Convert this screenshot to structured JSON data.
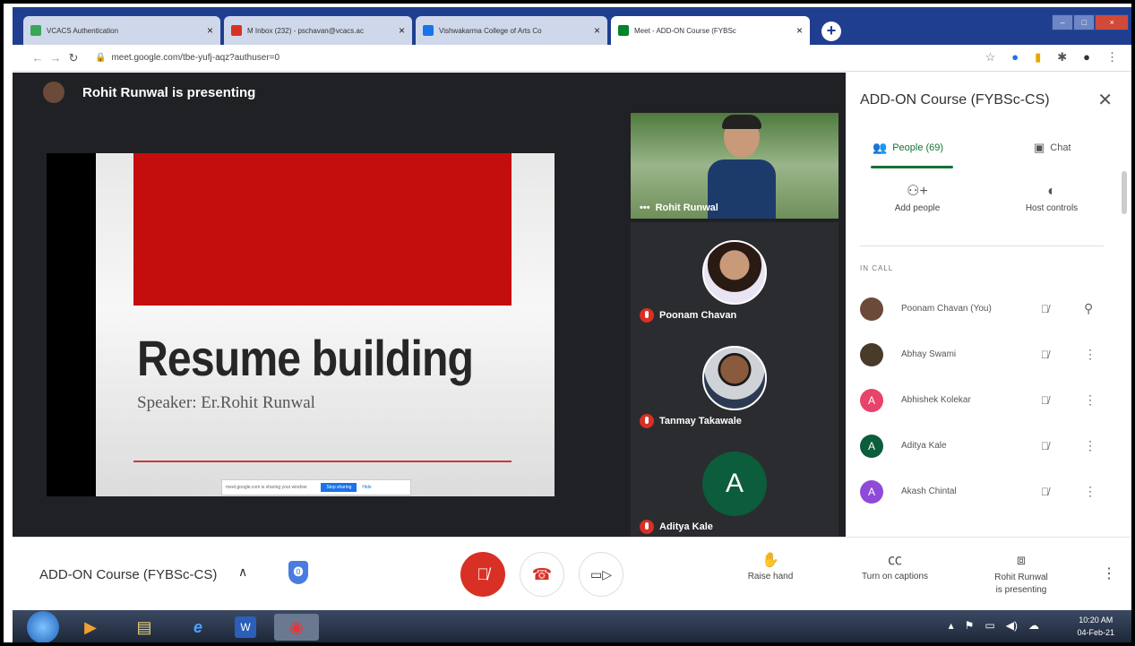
{
  "browser": {
    "tabs": [
      {
        "title": "VCACS Authentication",
        "fav_color": "#3aa657"
      },
      {
        "title": "M Inbox (232) - pschavan@vcacs.ac",
        "fav_color": "#d93025"
      },
      {
        "title": "Vishwakarma College of Arts Co",
        "fav_color": "#1a73e8"
      },
      {
        "title": "Meet - ADD-ON Course (FYBSc",
        "fav_color": "#00832d"
      }
    ],
    "url": "meet.google.com/tbe-yufj-aqz?authuser=0"
  },
  "presenting": {
    "banner": "Rohit Runwal is presenting"
  },
  "slide": {
    "title": "Resume building",
    "subtitle": "Speaker: Er.Rohit Runwal",
    "notice": "meet.google.com is sharing your window",
    "stop_label": "Stop sharing",
    "hide_label": "Hide"
  },
  "tiles": [
    {
      "name": "Rohit Runwal",
      "type": "camera"
    },
    {
      "name": "Poonam Chavan",
      "type": "photo"
    },
    {
      "name": "Tanmay Takawale",
      "type": "photo"
    },
    {
      "name": "Aditya Kale",
      "type": "letter",
      "letter": "A"
    }
  ],
  "panel": {
    "title": "ADD-ON Course (FYBSc-CS)",
    "people_tab": "People (69)",
    "chat_tab": "Chat",
    "add_people": "Add people",
    "host_controls": "Host controls",
    "in_call": "IN CALL",
    "participants": [
      {
        "name": "Poonam Chavan (You)",
        "avatar": "",
        "color": "#6b4a3a"
      },
      {
        "name": "Abhay Swami",
        "avatar": "",
        "color": "#4a3a2a"
      },
      {
        "name": "Abhishek Kolekar",
        "avatar": "A",
        "color": "#e8436a"
      },
      {
        "name": "Aditya Kale",
        "avatar": "A",
        "color": "#0b5d3b"
      },
      {
        "name": "Akash Chintal",
        "avatar": "A",
        "color": "#8e4ad8"
      }
    ]
  },
  "controls": {
    "meeting_name": "ADD-ON Course (FYBSc-CS)",
    "raise_hand": "Raise hand",
    "captions": "Turn on captions",
    "presenting_line1": "Rohit Runwal",
    "presenting_line2": "is presenting"
  },
  "taskbar": {
    "time": "10:20 AM",
    "date": "04-Feb-21"
  }
}
